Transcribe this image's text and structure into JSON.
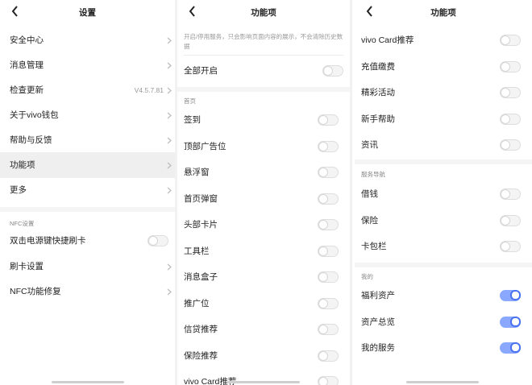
{
  "panel1": {
    "title": "设置",
    "items": [
      {
        "label": "安全中心"
      },
      {
        "label": "消息管理"
      },
      {
        "label": "检查更新",
        "value": "V4.5.7.81"
      },
      {
        "label": "关于vivo钱包"
      },
      {
        "label": "帮助与反馈"
      },
      {
        "label": "功能项",
        "active": true
      },
      {
        "label": "更多"
      }
    ],
    "nfc_section": "NFC设置",
    "nfc_items": [
      {
        "label": "双击电源键快捷刷卡",
        "toggle": false
      },
      {
        "label": "刷卡设置"
      },
      {
        "label": "NFC功能修复"
      }
    ]
  },
  "panel2": {
    "title": "功能项",
    "note": "开启/停用服务，只会影响页面内容的展示，不会清除历史数据",
    "all_on": {
      "label": "全部开启",
      "on": false
    },
    "home_section": "首页",
    "items": [
      {
        "label": "签到",
        "on": false
      },
      {
        "label": "顶部广告位",
        "on": false
      },
      {
        "label": "悬浮窗",
        "on": false
      },
      {
        "label": "首页弹窗",
        "on": false
      },
      {
        "label": "头部卡片",
        "on": false
      },
      {
        "label": "工具栏",
        "on": false
      },
      {
        "label": "消息盒子",
        "on": false
      },
      {
        "label": "推广位",
        "on": false
      },
      {
        "label": "信贷推荐",
        "on": false
      },
      {
        "label": "保险推荐",
        "on": false
      },
      {
        "label": "vivo Card推荐",
        "on": false
      }
    ]
  },
  "panel3": {
    "title": "功能项",
    "items_top": [
      {
        "label": "vivo Card推荐",
        "on": false
      },
      {
        "label": "充值缴费",
        "on": false
      },
      {
        "label": "精彩活动",
        "on": false
      },
      {
        "label": "新手帮助",
        "on": false
      },
      {
        "label": "资讯",
        "on": false
      }
    ],
    "service_section": "服务导航",
    "items_service": [
      {
        "label": "借钱",
        "on": false
      },
      {
        "label": "保险",
        "on": false
      },
      {
        "label": "卡包栏",
        "on": false
      }
    ],
    "mine_section": "我的",
    "items_mine": [
      {
        "label": "福利资产",
        "on": true
      },
      {
        "label": "资产总览",
        "on": true
      },
      {
        "label": "我的服务",
        "on": true
      }
    ]
  },
  "colors": {
    "toggle_on": "#4a72f2",
    "toggle_on_track": "#8aa8ff",
    "active_row": "#efeff0"
  },
  "icons": {
    "back": "chevron-left-icon",
    "arrow": "chevron-right-icon"
  }
}
